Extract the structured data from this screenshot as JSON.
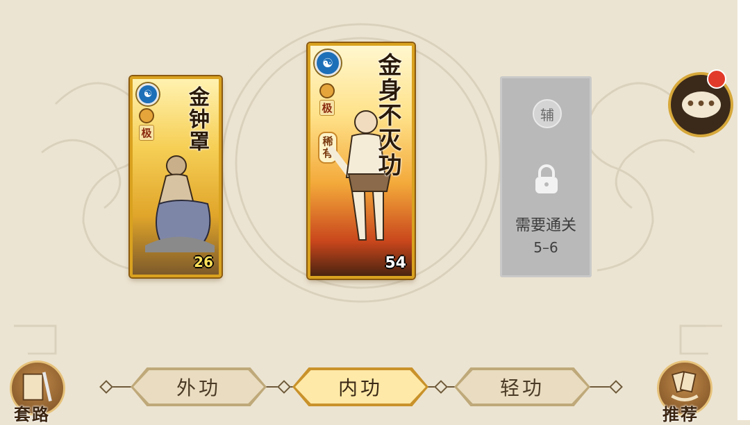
{
  "cards": {
    "left": {
      "title": "金钟罩",
      "grade": "极",
      "count": "26",
      "type_icon": "yin-yang-icon"
    },
    "middle": {
      "title": "金身不灭功",
      "grade": "极",
      "rarity": "稀有",
      "count": "54",
      "type_icon": "yin-yang-icon"
    },
    "locked": {
      "role": "辅",
      "requirement": "需要通关",
      "stage": "5–6"
    }
  },
  "tabs": [
    {
      "label": "外功",
      "active": false
    },
    {
      "label": "内功",
      "active": true
    },
    {
      "label": "轻功",
      "active": false
    }
  ],
  "corner_buttons": {
    "left_label": "套路",
    "right_label": "推荐"
  },
  "chat": {
    "dots": "•••",
    "has_notification": true
  },
  "colors": {
    "gold": "#d9a21f",
    "active_tab": "#ffe9a8",
    "notification": "#e23a2a",
    "locked": "#b9b9b9"
  }
}
